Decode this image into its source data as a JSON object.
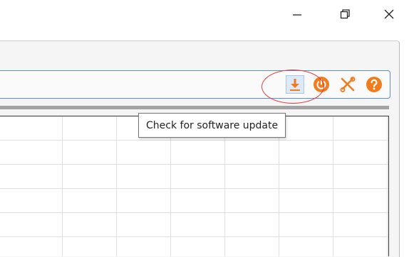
{
  "window": {
    "controls": [
      {
        "name": "minimize",
        "icon": "minimize-icon"
      },
      {
        "name": "restore",
        "icon": "restore-icon"
      },
      {
        "name": "close",
        "icon": "close-icon"
      }
    ]
  },
  "toolbar": {
    "buttons": [
      {
        "name": "check-for-update",
        "icon": "download-arrow-icon",
        "hovered": true
      },
      {
        "name": "power",
        "icon": "power-icon"
      },
      {
        "name": "tools",
        "icon": "tools-icon"
      },
      {
        "name": "help",
        "icon": "help-icon"
      }
    ]
  },
  "tooltip": {
    "text": "Check for software update"
  },
  "colors": {
    "accent_orange": "#f07c1e",
    "highlight_red": "#e03a3a",
    "toolbar_border": "#5b8fd4",
    "hover_fill": "#dce9f8"
  }
}
